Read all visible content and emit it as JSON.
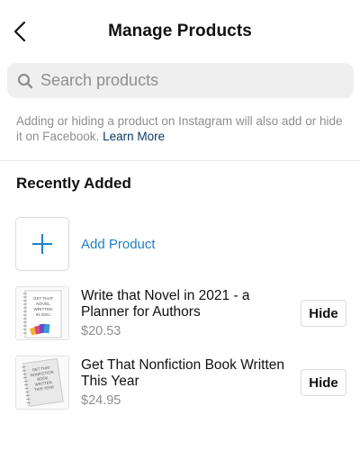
{
  "header": {
    "title": "Manage Products",
    "back_icon": "chevron-left-icon"
  },
  "search": {
    "placeholder": "Search products",
    "value": "",
    "icon": "search-icon"
  },
  "info": {
    "text": "Adding or hiding a product on Instagram will also add or hide it on Facebook. ",
    "link": "Learn More"
  },
  "section": {
    "title": "Recently Added"
  },
  "add_product": {
    "label": "Add Product",
    "icon": "plus-icon",
    "accent": "#1f7fc4"
  },
  "products": [
    {
      "name": "Write that Novel in 2021 - a Planner for Authors",
      "price": "$20.53",
      "action": "Hide",
      "thumb_text": [
        "GET THAT",
        "NOVEL",
        "WRITTEN",
        "IN 2021"
      ]
    },
    {
      "name": "Get That Nonfiction Book Written This Year",
      "price": "$24.95",
      "action": "Hide",
      "thumb_text": [
        "GET THAT",
        "NONFICTION",
        "BOOK",
        "WRITTEN",
        "THIS YEAR"
      ]
    }
  ]
}
